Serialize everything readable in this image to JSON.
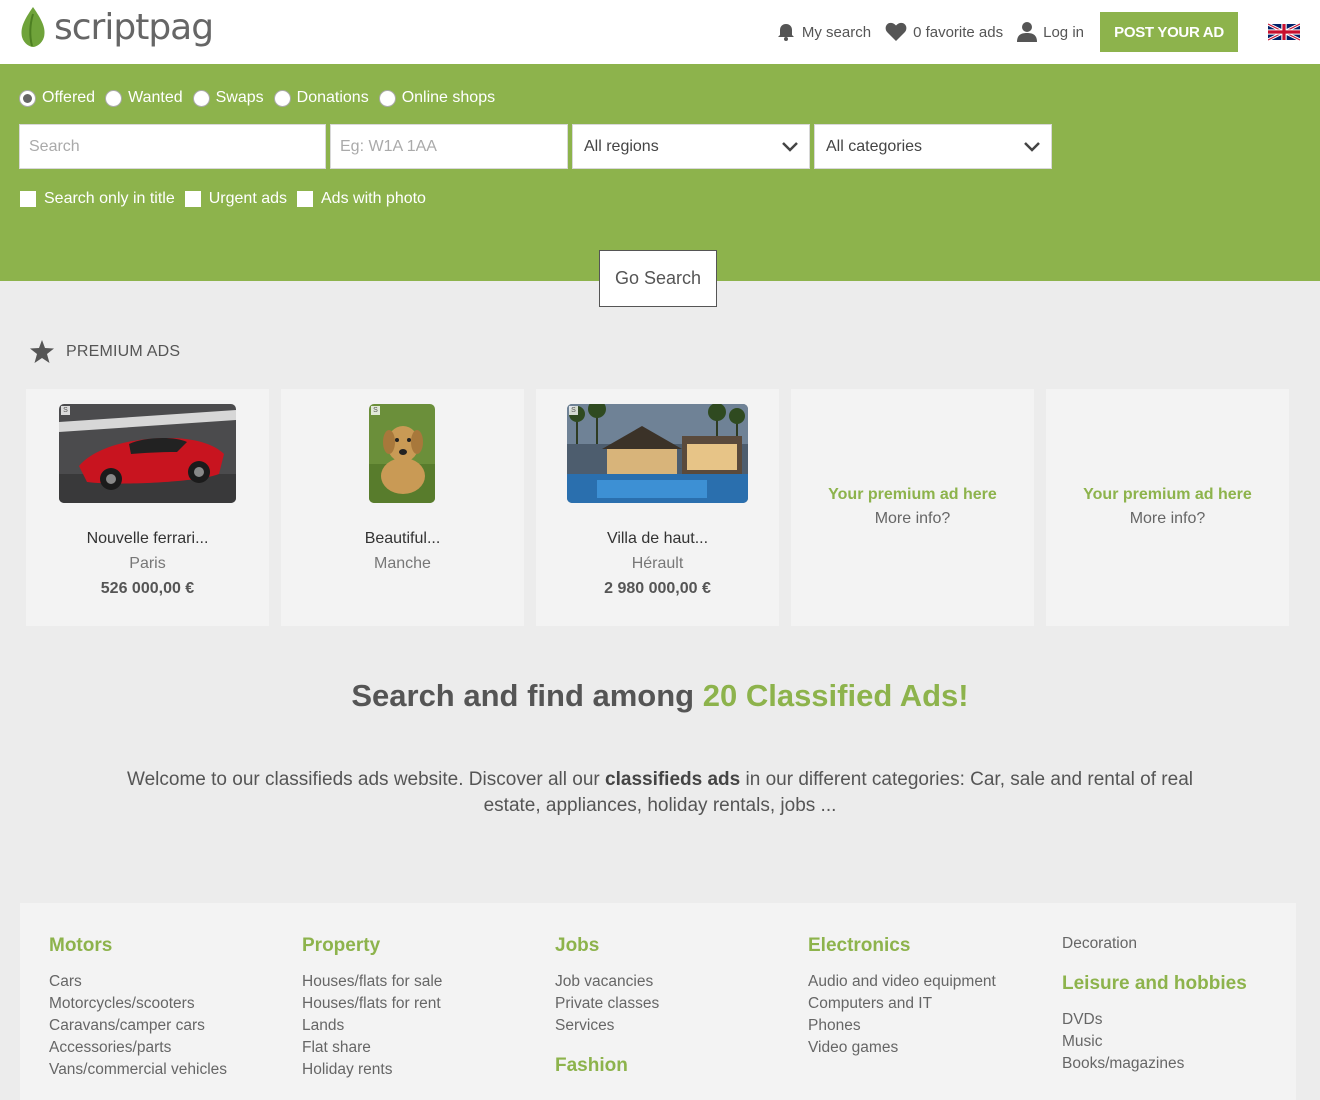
{
  "header": {
    "logo_text": "scriptpag",
    "my_search": "My search",
    "favorites": "0 favorite ads",
    "login": "Log in",
    "post_ad": "POST YOUR AD",
    "language": "English (UK flag)"
  },
  "search": {
    "types": [
      "Offered",
      "Wanted",
      "Swaps",
      "Donations",
      "Online shops"
    ],
    "selected_type": "Offered",
    "keyword_placeholder": "Search",
    "postcode_placeholder": "Eg: W1A 1AA",
    "region_value": "All regions",
    "category_value": "All categories",
    "filters": [
      "Search only in title",
      "Urgent ads",
      "Ads with photo"
    ],
    "submit": "Go Search"
  },
  "premium": {
    "heading": "PREMIUM ADS",
    "ads": [
      {
        "title": "Nouvelle ferrari...",
        "location": "Paris",
        "price": "526 000,00 €",
        "image": "red sports car"
      },
      {
        "title": "Beautiful...",
        "location": "Manche",
        "price": "",
        "image": "golden retriever dog"
      },
      {
        "title": "Villa de haut...",
        "location": "Hérault",
        "price": "2 980 000,00 €",
        "image": "villa with pool"
      }
    ],
    "placeholder": {
      "promo": "Your premium ad here",
      "more": "More info?"
    }
  },
  "headline": {
    "prefix": "Search and find among ",
    "highlight": "20 Classified Ads!"
  },
  "intro": {
    "before": "Welcome to our classifieds ads website. Discover all our ",
    "bold": "classifieds ads",
    "after": " in our different categories: Car, sale and rental of real estate, appliances, holiday rentals, jobs ..."
  },
  "categories": {
    "motors": {
      "title": "Motors",
      "items": [
        "Cars",
        "Motorcycles/scooters",
        "Caravans/camper cars",
        "Accessories/parts",
        "Vans/commercial vehicles"
      ]
    },
    "property": {
      "title": "Property",
      "items": [
        "Houses/flats for sale",
        "Houses/flats for rent",
        "Lands",
        "Flat share",
        "Holiday rents"
      ]
    },
    "jobs": {
      "title": "Jobs",
      "items": [
        "Job vacancies",
        "Private classes",
        "Services"
      ]
    },
    "fashion": {
      "title": "Fashion"
    },
    "electronics": {
      "title": "Electronics",
      "items": [
        "Audio and video equipment",
        "Computers and IT",
        "Phones",
        "Video games"
      ]
    },
    "decoration": {
      "title": "Decoration"
    },
    "leisure": {
      "title": "Leisure and hobbies",
      "items": [
        "DVDs",
        "Music",
        "Books/magazines"
      ]
    }
  },
  "colors": {
    "brand_green": "#8db34c",
    "background": "#ececec",
    "card": "#f3f3f3"
  }
}
